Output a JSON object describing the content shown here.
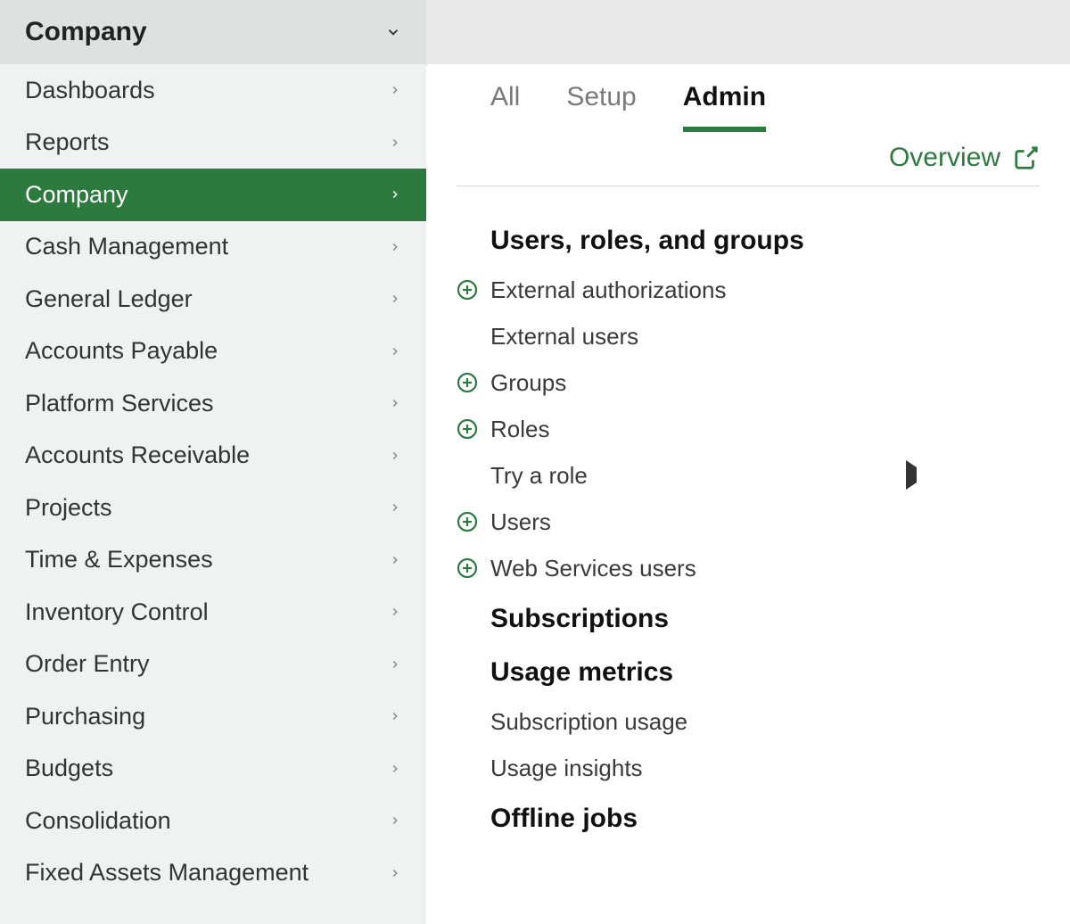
{
  "sidebar": {
    "header": "Company",
    "items": [
      {
        "label": "Dashboards",
        "active": false
      },
      {
        "label": "Reports",
        "active": false
      },
      {
        "label": "Company",
        "active": true
      },
      {
        "label": "Cash Management",
        "active": false
      },
      {
        "label": "General Ledger",
        "active": false
      },
      {
        "label": "Accounts Payable",
        "active": false
      },
      {
        "label": "Platform Services",
        "active": false
      },
      {
        "label": "Accounts Receivable",
        "active": false
      },
      {
        "label": "Projects",
        "active": false
      },
      {
        "label": "Time & Expenses",
        "active": false
      },
      {
        "label": "Inventory Control",
        "active": false
      },
      {
        "label": "Order Entry",
        "active": false
      },
      {
        "label": "Purchasing",
        "active": false
      },
      {
        "label": "Budgets",
        "active": false
      },
      {
        "label": "Consolidation",
        "active": false
      },
      {
        "label": "Fixed Assets Management",
        "active": false
      }
    ]
  },
  "main": {
    "tabs": [
      {
        "label": "All",
        "active": false
      },
      {
        "label": "Setup",
        "active": false
      },
      {
        "label": "Admin",
        "active": true
      }
    ],
    "overview_label": "Overview",
    "sections": [
      {
        "heading": "Users, roles, and groups",
        "items": [
          {
            "label": "External authorizations",
            "has_add": true,
            "has_submenu": false
          },
          {
            "label": "External users",
            "has_add": false,
            "has_submenu": false
          },
          {
            "label": "Groups",
            "has_add": true,
            "has_submenu": false
          },
          {
            "label": "Roles",
            "has_add": true,
            "has_submenu": false
          },
          {
            "label": "Try a role",
            "has_add": false,
            "has_submenu": true
          },
          {
            "label": "Users",
            "has_add": true,
            "has_submenu": false
          },
          {
            "label": "Web Services users",
            "has_add": true,
            "has_submenu": false
          }
        ]
      },
      {
        "heading": "Subscriptions",
        "items": []
      },
      {
        "heading": "Usage metrics",
        "items": [
          {
            "label": "Subscription usage",
            "has_add": false,
            "has_submenu": false
          },
          {
            "label": "Usage insights",
            "has_add": false,
            "has_submenu": false
          }
        ]
      },
      {
        "heading": "Offline jobs",
        "items": []
      }
    ]
  },
  "colors": {
    "accent": "#2d7a3e",
    "sidebar_bg": "#f0f2f2",
    "sidebar_header_bg": "#dfe1e1"
  }
}
